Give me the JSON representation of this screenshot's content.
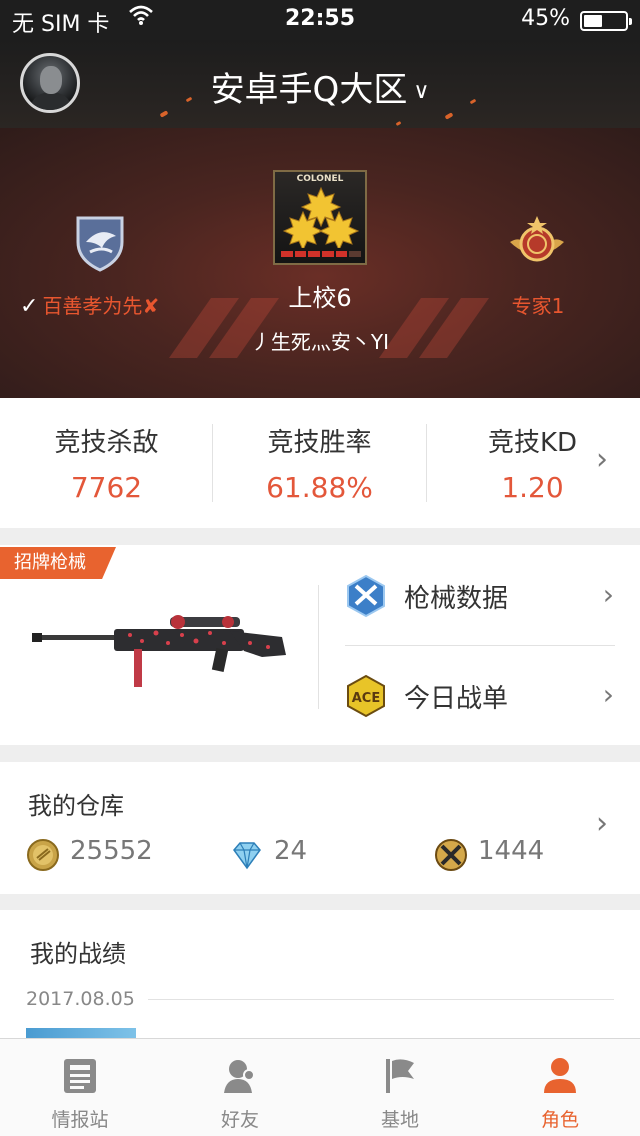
{
  "status_bar": {
    "carrier": "无 SIM 卡",
    "time": "22:55",
    "battery": "45%",
    "battery_level": 0.45
  },
  "header": {
    "server": "安卓手Q大区"
  },
  "banner": {
    "team_name": "百善孝为先",
    "team_mark": "✘",
    "rank_badge_label": "COLONEL",
    "rank_name": "上校6",
    "player_name": "丿生死灬安丶YI",
    "expert_label": "专家1"
  },
  "stats": [
    {
      "title": "竞技杀敌",
      "value": "7762"
    },
    {
      "title": "竞技胜率",
      "value": "61.88%"
    },
    {
      "title": "竞技KD",
      "value": "1.20"
    }
  ],
  "weapon": {
    "tag": "招牌枪械",
    "menu": [
      {
        "label": "枪械数据",
        "icon": "weapon-data-icon"
      },
      {
        "label": "今日战单",
        "icon": "ace-icon"
      }
    ]
  },
  "warehouse": {
    "title": "我的仓库",
    "items": [
      {
        "icon": "gold-coin-icon",
        "value": "25552"
      },
      {
        "icon": "diamond-icon",
        "value": "24"
      },
      {
        "icon": "crossed-guns-icon",
        "value": "1444"
      }
    ]
  },
  "records": {
    "title": "我的战绩",
    "date": "2017.08.05"
  },
  "tabs": [
    {
      "label": "情报站",
      "icon": "news-icon"
    },
    {
      "label": "好友",
      "icon": "friends-icon"
    },
    {
      "label": "基地",
      "icon": "flag-icon"
    },
    {
      "label": "角色",
      "icon": "person-icon"
    }
  ],
  "colors": {
    "accent": "#e8632f",
    "value": "#e3573a",
    "header": "#1d1d1d"
  }
}
